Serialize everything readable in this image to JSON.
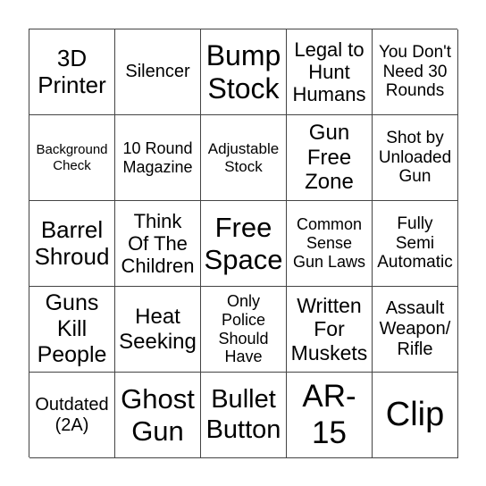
{
  "cells": [
    "3D\nPrinter",
    "Silencer",
    "Bump\nStock",
    "Legal to\nHunt\nHumans",
    "You Don't\nNeed 30\nRounds",
    "Background\nCheck",
    "10 Round\nMagazine",
    "Adjustable\nStock",
    "Gun\nFree\nZone",
    "Shot by\nUnloaded\nGun",
    "Barrel\nShroud",
    "Think\nOf The\nChildren",
    "Free\nSpace",
    "Common\nSense\nGun Laws",
    "Fully\nSemi\nAutomatic",
    "Guns\nKill\nPeople",
    "Heat\nSeeking",
    "Only\nPolice\nShould\nHave",
    "Written\nFor\nMuskets",
    "Assault\nWeapon/\nRifle",
    "Outdated\n(2A)",
    "Ghost\nGun",
    "Bullet\nButton",
    "AR-\n15",
    "Clip"
  ]
}
